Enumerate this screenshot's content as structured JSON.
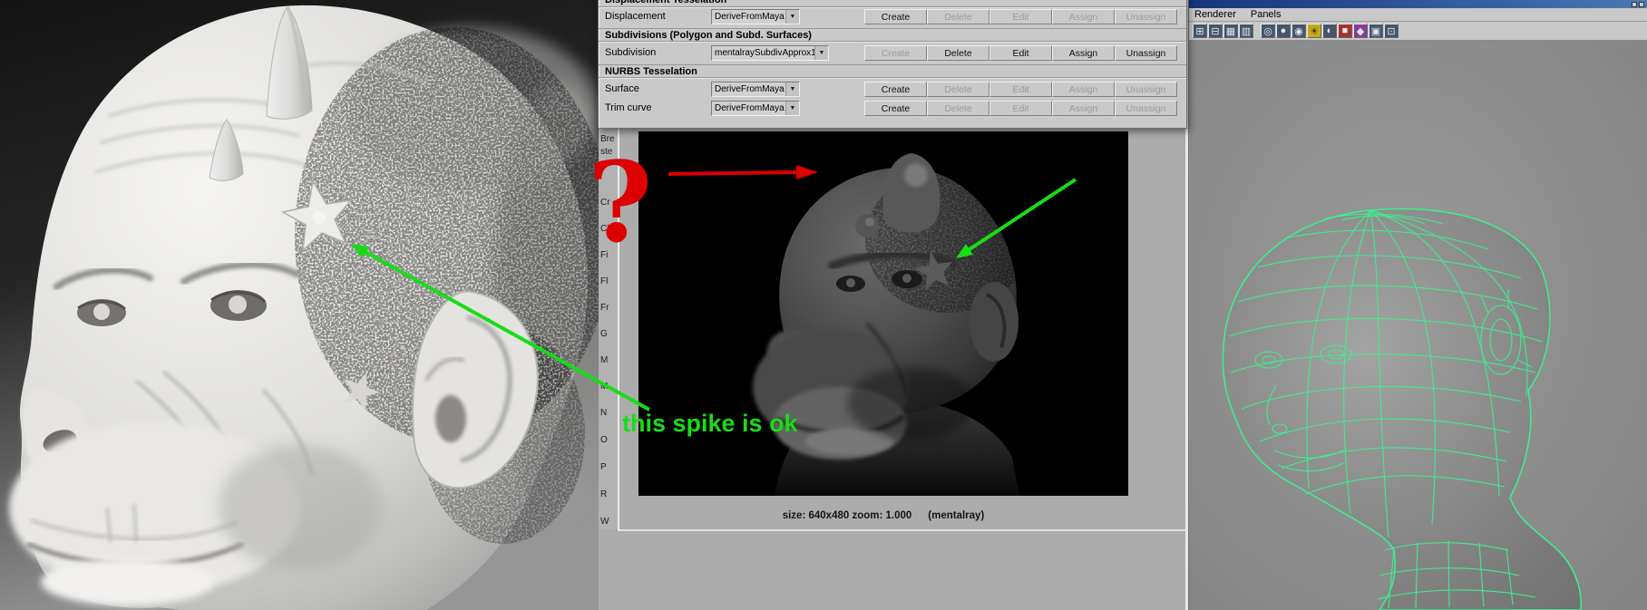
{
  "dialog": {
    "sections": {
      "displacement": "Displacement Tesselation",
      "subdivisions": "Subdivisions (Polygon and Subd. Surfaces)",
      "nurbs": "NURBS Tesselation"
    },
    "chevron": "▼",
    "rows": [
      {
        "label": "Displacement",
        "value": "DeriveFromMaya",
        "buttons": [
          {
            "label": "Create",
            "enabled": true
          },
          {
            "label": "Delete",
            "enabled": false
          },
          {
            "label": "Edit",
            "enabled": false
          },
          {
            "label": "Assign",
            "enabled": false
          },
          {
            "label": "Unassign",
            "enabled": false
          }
        ]
      },
      {
        "label": "Subdivision",
        "value": "mentalraySubdivApprox1",
        "buttons": [
          {
            "label": "Create",
            "enabled": false
          },
          {
            "label": "Delete",
            "enabled": true
          },
          {
            "label": "Edit",
            "enabled": true
          },
          {
            "label": "Assign",
            "enabled": true
          },
          {
            "label": "Unassign",
            "enabled": true
          }
        ]
      },
      {
        "label": "Surface",
        "value": "DeriveFromMaya",
        "buttons": [
          {
            "label": "Create",
            "enabled": true
          },
          {
            "label": "Delete",
            "enabled": false
          },
          {
            "label": "Edit",
            "enabled": false
          },
          {
            "label": "Assign",
            "enabled": false
          },
          {
            "label": "Unassign",
            "enabled": false
          }
        ]
      },
      {
        "label": "Trim curve",
        "value": "DeriveFromMaya",
        "buttons": [
          {
            "label": "Create",
            "enabled": true
          },
          {
            "label": "Delete",
            "enabled": false
          },
          {
            "label": "Edit",
            "enabled": false
          },
          {
            "label": "Assign",
            "enabled": false
          },
          {
            "label": "Unassign",
            "enabled": false
          }
        ]
      }
    ]
  },
  "attribute_strip": {
    "fragments": [
      "Bre",
      "ste",
      "Cr",
      "Cl",
      "Fi",
      "Fl",
      "Fr",
      "G",
      "M",
      "M",
      "N",
      "O",
      "P",
      "R",
      "W"
    ]
  },
  "render_view": {
    "status_size": "size: 640x480 zoom: 1.000",
    "status_renderer": "(mentalray)"
  },
  "right_panel": {
    "menu_items": [
      "Renderer",
      "Panels"
    ],
    "toolbar_glyphs": [
      "⊞",
      "⊟",
      "▦",
      "▥",
      "◎",
      "●",
      "◉",
      "☀",
      "◐",
      "■",
      "◆",
      "▣",
      "⊡"
    ]
  },
  "annotations": {
    "question_mark": "?",
    "spike_note": "this spike is ok",
    "red": "#dd0000",
    "green": "#17dd17"
  }
}
